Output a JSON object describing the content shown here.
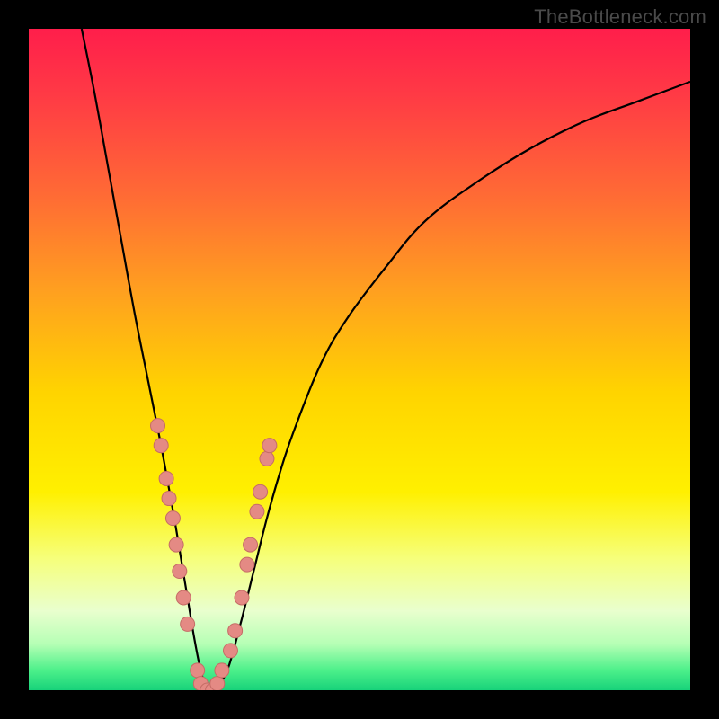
{
  "watermark": "TheBottleneck.com",
  "colors": {
    "frame": "#000000",
    "curve": "#000000",
    "marker_fill": "#e48a84",
    "marker_stroke": "#c56c66",
    "gradient_stops": [
      {
        "offset": 0.0,
        "color": "#ff1e4b"
      },
      {
        "offset": 0.1,
        "color": "#ff3a45"
      },
      {
        "offset": 0.25,
        "color": "#ff6a35"
      },
      {
        "offset": 0.4,
        "color": "#ffa11f"
      },
      {
        "offset": 0.55,
        "color": "#ffd400"
      },
      {
        "offset": 0.7,
        "color": "#fff000"
      },
      {
        "offset": 0.8,
        "color": "#f6ff7a"
      },
      {
        "offset": 0.88,
        "color": "#e9ffce"
      },
      {
        "offset": 0.93,
        "color": "#b6ffb5"
      },
      {
        "offset": 0.97,
        "color": "#4cf08a"
      },
      {
        "offset": 1.0,
        "color": "#17d27a"
      }
    ]
  },
  "chart_data": {
    "type": "line",
    "title": "",
    "xlabel": "",
    "ylabel": "",
    "xlim": [
      0,
      100
    ],
    "ylim": [
      0,
      100
    ],
    "grid": false,
    "legend": false,
    "series": [
      {
        "name": "bottleneck-curve",
        "x": [
          8,
          10,
          12,
          14,
          16,
          18,
          20,
          22,
          23,
          24,
          25,
          26,
          27,
          28,
          30,
          32,
          34,
          36,
          38,
          40,
          44,
          48,
          54,
          60,
          68,
          76,
          84,
          92,
          100
        ],
        "y": [
          100,
          90,
          79,
          68,
          57,
          47,
          37,
          26,
          20,
          14,
          8,
          3,
          0,
          0,
          3,
          10,
          18,
          26,
          33,
          39,
          49,
          56,
          64,
          71,
          77,
          82,
          86,
          89,
          92
        ]
      }
    ],
    "markers": {
      "name": "highlighted-points",
      "points": [
        {
          "x": 19.5,
          "y": 40
        },
        {
          "x": 20.0,
          "y": 37
        },
        {
          "x": 20.8,
          "y": 32
        },
        {
          "x": 21.2,
          "y": 29
        },
        {
          "x": 21.8,
          "y": 26
        },
        {
          "x": 22.3,
          "y": 22
        },
        {
          "x": 22.8,
          "y": 18
        },
        {
          "x": 23.4,
          "y": 14
        },
        {
          "x": 24.0,
          "y": 10
        },
        {
          "x": 25.5,
          "y": 3
        },
        {
          "x": 26.0,
          "y": 1
        },
        {
          "x": 27.0,
          "y": 0
        },
        {
          "x": 27.8,
          "y": 0
        },
        {
          "x": 28.5,
          "y": 1
        },
        {
          "x": 29.2,
          "y": 3
        },
        {
          "x": 30.5,
          "y": 6
        },
        {
          "x": 31.2,
          "y": 9
        },
        {
          "x": 32.2,
          "y": 14
        },
        {
          "x": 33.0,
          "y": 19
        },
        {
          "x": 33.5,
          "y": 22
        },
        {
          "x": 34.5,
          "y": 27
        },
        {
          "x": 35.0,
          "y": 30
        },
        {
          "x": 36.0,
          "y": 35
        },
        {
          "x": 36.4,
          "y": 37
        }
      ]
    }
  }
}
